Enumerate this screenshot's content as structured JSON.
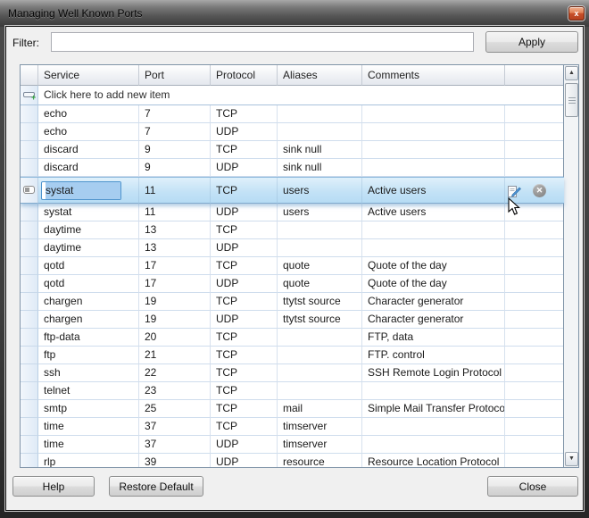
{
  "window": {
    "title": "Managing Well Known Ports",
    "close_glyph": "x"
  },
  "filter": {
    "label": "Filter:",
    "value": "",
    "placeholder": "",
    "apply_label": "Apply"
  },
  "grid": {
    "columns": [
      "Service",
      "Port",
      "Protocol",
      "Aliases",
      "Comments",
      ""
    ],
    "new_item_label": "Click here to add new item",
    "rows": [
      {
        "service": "echo",
        "port": "7",
        "protocol": "TCP",
        "aliases": "",
        "comments": ""
      },
      {
        "service": "echo",
        "port": "7",
        "protocol": "UDP",
        "aliases": "",
        "comments": ""
      },
      {
        "service": "discard",
        "port": "9",
        "protocol": "TCP",
        "aliases": "sink null",
        "comments": ""
      },
      {
        "service": "discard",
        "port": "9",
        "protocol": "UDP",
        "aliases": "sink null",
        "comments": ""
      },
      {
        "service": "systat",
        "port": "11",
        "protocol": "TCP",
        "aliases": "users",
        "comments": "Active users",
        "editing": true
      },
      {
        "service": "systat",
        "port": "11",
        "protocol": "UDP",
        "aliases": "users",
        "comments": "Active users"
      },
      {
        "service": "daytime",
        "port": "13",
        "protocol": "TCP",
        "aliases": "",
        "comments": ""
      },
      {
        "service": "daytime",
        "port": "13",
        "protocol": "UDP",
        "aliases": "",
        "comments": ""
      },
      {
        "service": "qotd",
        "port": "17",
        "protocol": "TCP",
        "aliases": "quote",
        "comments": "Quote of the day"
      },
      {
        "service": "qotd",
        "port": "17",
        "protocol": "UDP",
        "aliases": "quote",
        "comments": "Quote of the day"
      },
      {
        "service": "chargen",
        "port": "19",
        "protocol": "TCP",
        "aliases": "ttytst source",
        "comments": "Character generator"
      },
      {
        "service": "chargen",
        "port": "19",
        "protocol": "UDP",
        "aliases": "ttytst source",
        "comments": "Character generator"
      },
      {
        "service": "ftp-data",
        "port": "20",
        "protocol": "TCP",
        "aliases": "",
        "comments": "FTP, data"
      },
      {
        "service": "ftp",
        "port": "21",
        "protocol": "TCP",
        "aliases": "",
        "comments": "FTP. control"
      },
      {
        "service": "ssh",
        "port": "22",
        "protocol": "TCP",
        "aliases": "",
        "comments": "SSH Remote Login Protocol"
      },
      {
        "service": "telnet",
        "port": "23",
        "protocol": "TCP",
        "aliases": "",
        "comments": ""
      },
      {
        "service": "smtp",
        "port": "25",
        "protocol": "TCP",
        "aliases": "mail",
        "comments": "Simple Mail Transfer Protocol"
      },
      {
        "service": "time",
        "port": "37",
        "protocol": "TCP",
        "aliases": "timserver",
        "comments": ""
      },
      {
        "service": "time",
        "port": "37",
        "protocol": "UDP",
        "aliases": "timserver",
        "comments": ""
      },
      {
        "service": "rlp",
        "port": "39",
        "protocol": "UDP",
        "aliases": "resource",
        "comments": "Resource Location Protocol"
      }
    ],
    "edit_row": {
      "service_value": "systat"
    }
  },
  "icons": {
    "scroll_up": "▲",
    "scroll_down": "▼",
    "cancel_glyph": "✕"
  },
  "footer": {
    "help_label": "Help",
    "restore_label": "Restore Default",
    "close_label": "Close"
  },
  "colors": {
    "edit_row_bg": "#c3e2f6",
    "selection": "#a6cdf0",
    "titlebar_close": "#c8502a",
    "grid_border": "#8094a8"
  }
}
